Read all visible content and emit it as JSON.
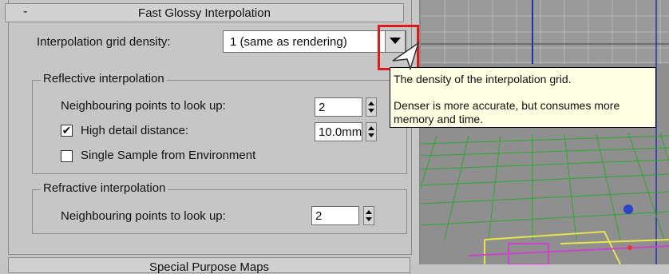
{
  "rollout": {
    "title": "Fast Glossy Interpolation",
    "collapse_symbol": "-",
    "grid_density_label": "Interpolation grid density:",
    "grid_density_value": "1 (same as rendering)",
    "reflective": {
      "group_title": "Reflective interpolation",
      "neighbours_label": "Neighbouring points to look up:",
      "neighbours_value": "2",
      "detail_label": "High detail distance:",
      "detail_checked": true,
      "detail_check_glyph": "✔",
      "detail_value": "10.0mm",
      "single_sample_label": "Single Sample from Environment",
      "single_sample_checked": false
    },
    "refractive": {
      "group_title": "Refractive interpolation",
      "neighbours_label": "Neighbouring points to look up:",
      "neighbours_value": "2"
    },
    "next_rollout_title": "Special Purpose Maps"
  },
  "tooltip": {
    "line1": "The density of the interpolation grid.",
    "line2": "Denser is more accurate, but consumes more",
    "line3": "memory and time."
  },
  "colors": {
    "highlight": "#e01a1a",
    "tooltip_bg": "#ffffe3",
    "panel_bg": "#c6c6c6",
    "viewport_bg": "#8f8f8f",
    "grid_green": "#2ea82e",
    "grid_blue": "#2233aa",
    "mesh_yellow": "#e6e64a",
    "mesh_magenta": "#cc44cc"
  },
  "icons": [
    "collapse-icon",
    "dropdown-arrow-icon",
    "spinner-up-icon",
    "spinner-down-icon",
    "checkbox-icon",
    "mouse-pointer-icon"
  ]
}
